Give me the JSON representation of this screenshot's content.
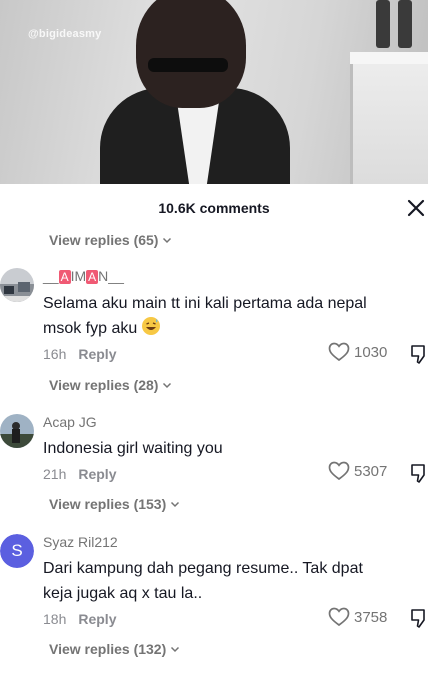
{
  "video": {
    "watermark": "@bigideasmy"
  },
  "comments_panel": {
    "count_label": "10.6K comments"
  },
  "top_view_replies": "View replies (65)",
  "comments": [
    {
      "username_prefix": "__",
      "username_a": "A",
      "username_mid1": "IM",
      "username_b": "A",
      "username_mid2": "N",
      "username_suffix": "__",
      "text": "Selama aku main tt ini kali pertama ada nepal msok fyp aku",
      "emoji": "grinning-face-with-sweat",
      "time": "16h",
      "reply_label": "Reply",
      "likes": "1030",
      "view_replies": "View replies (28)"
    },
    {
      "username": "Acap JG",
      "text": "Indonesia girl waiting you",
      "time": "21h",
      "reply_label": "Reply",
      "likes": "5307",
      "view_replies": "View replies (153)"
    },
    {
      "username": "Syaz Ril212",
      "avatar_letter": "S",
      "avatar_color": "#5b5fe0",
      "text": "Dari kampung dah pegang resume.. Tak dpat keja jugak aq x tau la..",
      "time": "18h",
      "reply_label": "Reply",
      "likes": "3758",
      "view_replies": "View replies (132)"
    }
  ],
  "colors": {
    "secondary_text": "#747474",
    "badge": "#f05a74"
  }
}
